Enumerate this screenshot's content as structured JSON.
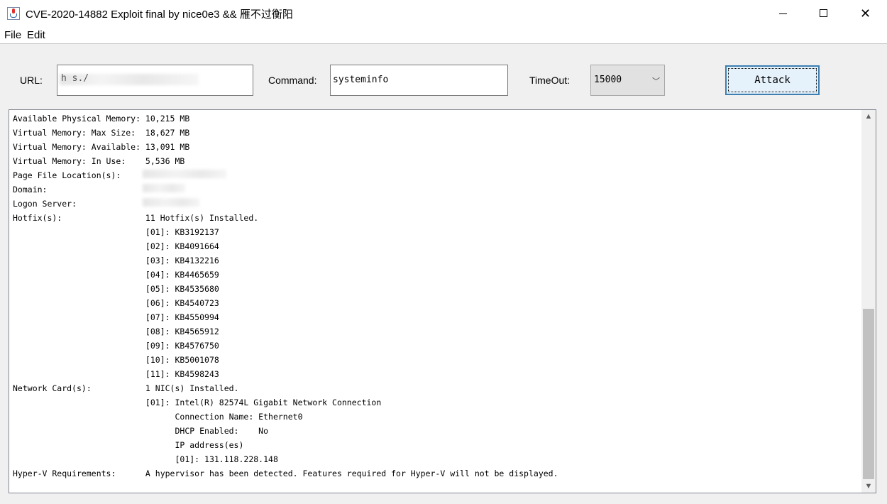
{
  "window": {
    "title": "CVE-2020-14882 Exploit final by nice0e3 && 雁不过衡阳",
    "minimize_glyph": "",
    "close_glyph": "✕"
  },
  "menu": [
    "File",
    "Edit"
  ],
  "form": {
    "url_label": "URL:",
    "url_value": "h   s./",
    "command_label": "Command:",
    "command_value": "systeminfo",
    "timeout_label": "TimeOut:",
    "timeout_value": "15000",
    "attack_label": "Attack"
  },
  "output": {
    "lines": [
      "Available Physical Memory: 10,215 MB",
      "Virtual Memory: Max Size:  18,627 MB",
      "Virtual Memory: Available: 13,091 MB",
      "Virtual Memory: In Use:    5,536 MB",
      "Page File Location(s):",
      "Domain:",
      "Logon Server:",
      "Hotfix(s):                 11 Hotfix(s) Installed.",
      "                           [01]: KB3192137",
      "                           [02]: KB4091664",
      "                           [03]: KB4132216",
      "                           [04]: KB4465659",
      "                           [05]: KB4535680",
      "                           [06]: KB4540723",
      "                           [07]: KB4550994",
      "                           [08]: KB4565912",
      "                           [09]: KB4576750",
      "                           [10]: KB5001078",
      "                           [11]: KB4598243",
      "Network Card(s):           1 NIC(s) Installed.",
      "                           [01]: Intel(R) 82574L Gigabit Network Connection",
      "                                 Connection Name: Ethernet0",
      "                                 DHCP Enabled:    No",
      "                                 IP address(es)",
      "                                 [01]: 131.118.228.148",
      "Hyper-V Requirements:      A hypervisor has been detected. Features required for Hyper-V will not be displayed."
    ]
  },
  "icons": {
    "app": "java-app-icon",
    "scroll_up": "▲",
    "scroll_down": "▼",
    "dropdown": "﹀"
  }
}
